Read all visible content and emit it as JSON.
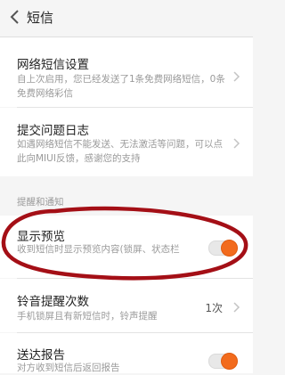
{
  "header": {
    "title": "短信"
  },
  "items": [
    {
      "title": "网络短信设置",
      "subtitle": "自上次启用，您已经发送了1条免费网络短信，0条免费网络彩信"
    },
    {
      "title": "提交问题日志",
      "subtitle": "如遇网络短信不能发送、无法激活等问题，可以点此向MIUI反馈，感谢您的支持"
    }
  ],
  "section": {
    "header": "提醒和通知"
  },
  "preview": {
    "title": "显示预览",
    "subtitle": "收到短信时显示预览内容(锁屏、状态栏",
    "enabled": true
  },
  "ringtone": {
    "title": "铃音提醒次数",
    "subtitle": "手机锁屏且有新短信时，铃声提醒",
    "value": "1次"
  },
  "report": {
    "title": "送达报告",
    "subtitle": "对方收到短信后返回报告",
    "enabled": true
  },
  "colors": {
    "accent": "#f26b1d",
    "annotation": "#a40f16"
  }
}
